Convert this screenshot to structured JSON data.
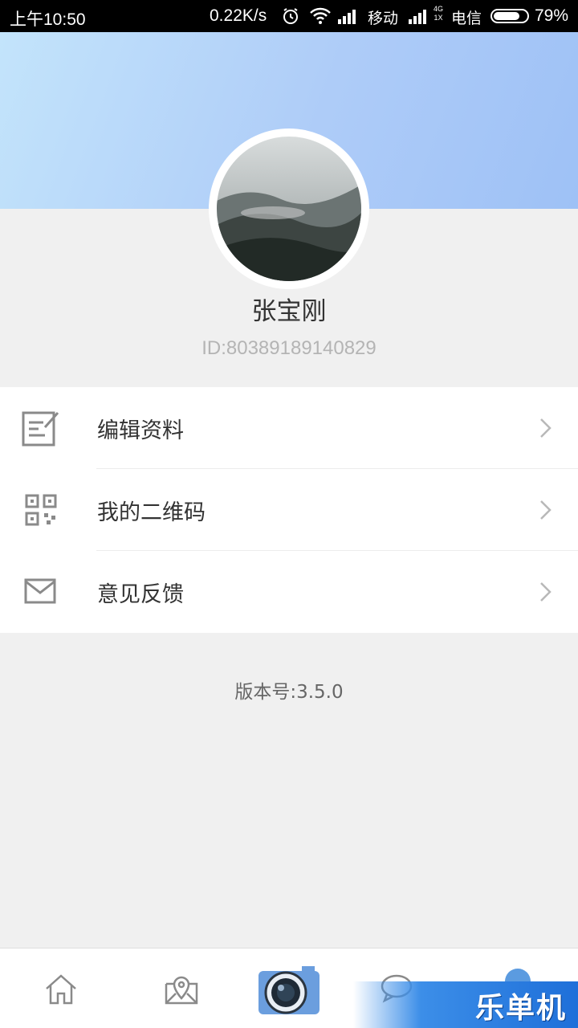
{
  "status_bar": {
    "time": "上午10:50",
    "speed": "0.22K/s",
    "carrier1": "移动",
    "network_top": "4G",
    "network_bottom": "1X",
    "carrier2": "电信",
    "battery_level": 0.79,
    "battery_text": "79%"
  },
  "profile": {
    "name": "张宝刚",
    "id_text": "ID:80389189140829",
    "avatar_icon": "avatar-mountain-photo"
  },
  "menu": {
    "items": [
      {
        "label": "编辑资料",
        "icon": "edit-icon"
      },
      {
        "label": "我的二维码",
        "icon": "qr-code-icon"
      },
      {
        "label": "意见反馈",
        "icon": "mail-icon"
      }
    ]
  },
  "version_text": "版本号:3.5.0",
  "bottom_nav": {
    "items": [
      "home-icon",
      "map-icon",
      "camera-icon",
      "chat-icon",
      "profile-icon"
    ]
  },
  "watermark": "乐单机",
  "colors": {
    "header_gradient_start": "#c3e4fb",
    "header_gradient_end": "#9ec1f6",
    "icon_gray": "#8a8a8a",
    "camera_blue": "#5b8fd6"
  }
}
